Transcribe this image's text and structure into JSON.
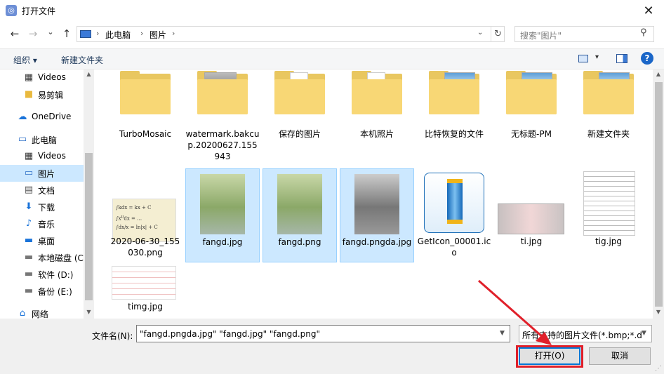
{
  "window": {
    "title": "打开文件",
    "close": "✕"
  },
  "nav": {
    "back": "←",
    "forward": "→",
    "recent": "⌄",
    "up": "↑"
  },
  "address": {
    "crumbs": [
      "此电脑",
      "图片"
    ],
    "sep": "›",
    "refresh": "↻",
    "dropdown": "⌄"
  },
  "search": {
    "placeholder": "搜索\"图片\"",
    "icon": "⚲"
  },
  "toolbar": {
    "organize": "组织 ▾",
    "new_folder": "新建文件夹",
    "view": "▾",
    "help": "?"
  },
  "sidebar": {
    "items": [
      {
        "label": "Videos",
        "icon": "video-icon",
        "glyph": "▦"
      },
      {
        "label": "易剪辑",
        "icon": "folder-icon",
        "glyph": "■"
      },
      {
        "label": "OneDrive",
        "icon": "cloud-icon",
        "glyph": "☁"
      },
      {
        "label": "此电脑",
        "icon": "computer-icon",
        "glyph": "▭"
      },
      {
        "label": "Videos",
        "icon": "video-icon",
        "glyph": "▦"
      },
      {
        "label": "图片",
        "icon": "pictures-icon",
        "glyph": "▭"
      },
      {
        "label": "文档",
        "icon": "document-icon",
        "glyph": "▤"
      },
      {
        "label": "下载",
        "icon": "download-icon",
        "glyph": "⬇"
      },
      {
        "label": "音乐",
        "icon": "music-icon",
        "glyph": "♪"
      },
      {
        "label": "桌面",
        "icon": "desktop-icon",
        "glyph": "▬"
      },
      {
        "label": "本地磁盘 (C",
        "icon": "drive-icon",
        "glyph": "▬"
      },
      {
        "label": "软件 (D:)",
        "icon": "drive-icon",
        "glyph": "▬"
      },
      {
        "label": "备份 (E:)",
        "icon": "drive-icon",
        "glyph": "▬"
      },
      {
        "label": "网络",
        "icon": "network-icon",
        "glyph": "⌂"
      }
    ],
    "selected": "图片"
  },
  "files": [
    {
      "name": "TurboMosaic",
      "kind": "folder"
    },
    {
      "name": "watermark.bakcup.20200627.155943",
      "kind": "folder"
    },
    {
      "name": "保存的图片",
      "kind": "folder"
    },
    {
      "name": "本机照片",
      "kind": "folder"
    },
    {
      "name": "比特恢复的文件",
      "kind": "folder"
    },
    {
      "name": "无标题-PM",
      "kind": "folder"
    },
    {
      "name": "新建文件夹",
      "kind": "folder"
    },
    {
      "name": "2020-06-30_155030.png",
      "kind": "image"
    },
    {
      "name": "fangd.jpg",
      "kind": "image",
      "selected": true
    },
    {
      "name": "fangd.png",
      "kind": "image",
      "selected": true
    },
    {
      "name": "fangd.pngda.jpg",
      "kind": "image",
      "selected": true
    },
    {
      "name": "GetIcon_00001.ico",
      "kind": "icon"
    },
    {
      "name": "ti.jpg",
      "kind": "image"
    },
    {
      "name": "tig.jpg",
      "kind": "image"
    },
    {
      "name": "timg.jpg",
      "kind": "image"
    }
  ],
  "bottom": {
    "filename_label": "文件名(N):",
    "filename_value": "\"fangd.pngda.jpg\" \"fangd.jpg\" \"fangd.png\"",
    "filetype_value": "所有支持的图片文件(*.bmp;*.d",
    "open_button": "打开(O)",
    "cancel_button": "取消"
  },
  "colors": {
    "selection": "#cce8ff",
    "highlight_red": "#e0202a",
    "folder": "#f8d775"
  }
}
